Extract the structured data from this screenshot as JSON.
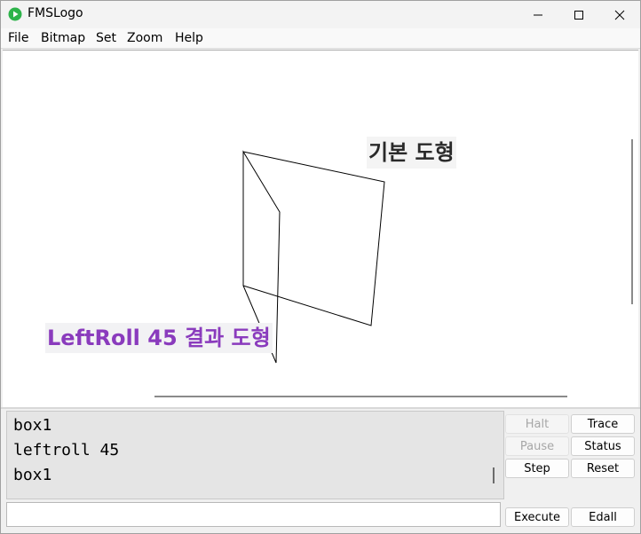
{
  "window": {
    "title": "FMSLogo",
    "icon": "play-icon",
    "icon_color": "#2db34a"
  },
  "menu": [
    "File",
    "Bitmap",
    "Set",
    "Zoom",
    "Help"
  ],
  "canvas": {
    "label_basic": "기본 도형",
    "label_leftroll": "LeftRoll 45 결과 도형",
    "label_leftroll_color": "#8a3bbd"
  },
  "commander": {
    "history": [
      "box1",
      "leftroll 45",
      "box1"
    ],
    "input_value": "",
    "buttons": {
      "halt": "Halt",
      "trace": "Trace",
      "pause": "Pause",
      "status": "Status",
      "step": "Step",
      "reset": "Reset",
      "execute": "Execute",
      "edall": "Edall"
    }
  }
}
